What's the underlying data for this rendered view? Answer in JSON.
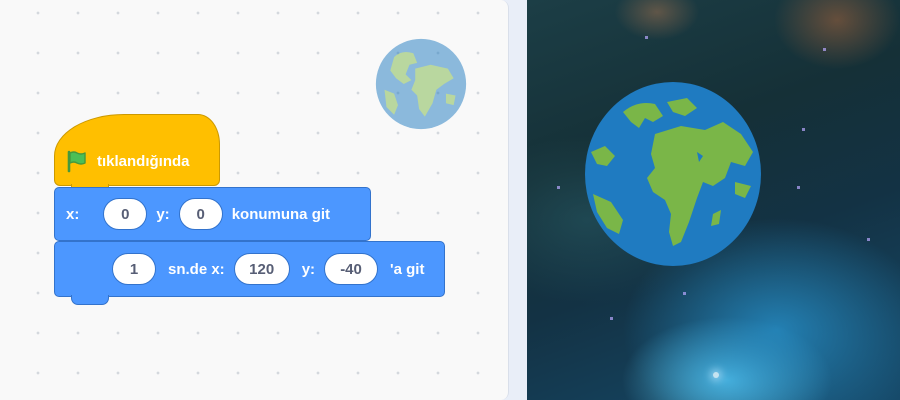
{
  "workspace": {
    "hat_block": {
      "label": "tıklandığında",
      "icon": "green-flag-icon"
    },
    "goto_block": {
      "x_label": "x:",
      "x_value": "0",
      "y_label": "y:",
      "y_value": "0",
      "suffix": "konumuna git"
    },
    "glide_block": {
      "secs_value": "1",
      "secs_label": "sn.de x:",
      "x_value": "120",
      "y_label": "y:",
      "y_value": "-40",
      "suffix": "'a git"
    },
    "sprite_thumbnail_icon": "earth-icon"
  },
  "stage": {
    "sprite_icon": "earth-icon",
    "backdrop": "nebula space"
  },
  "colors": {
    "event_block": "#ffbf00",
    "motion_block": "#4c97ff",
    "earth_ocean": "#1f7bc1",
    "earth_land": "#7ab648"
  }
}
